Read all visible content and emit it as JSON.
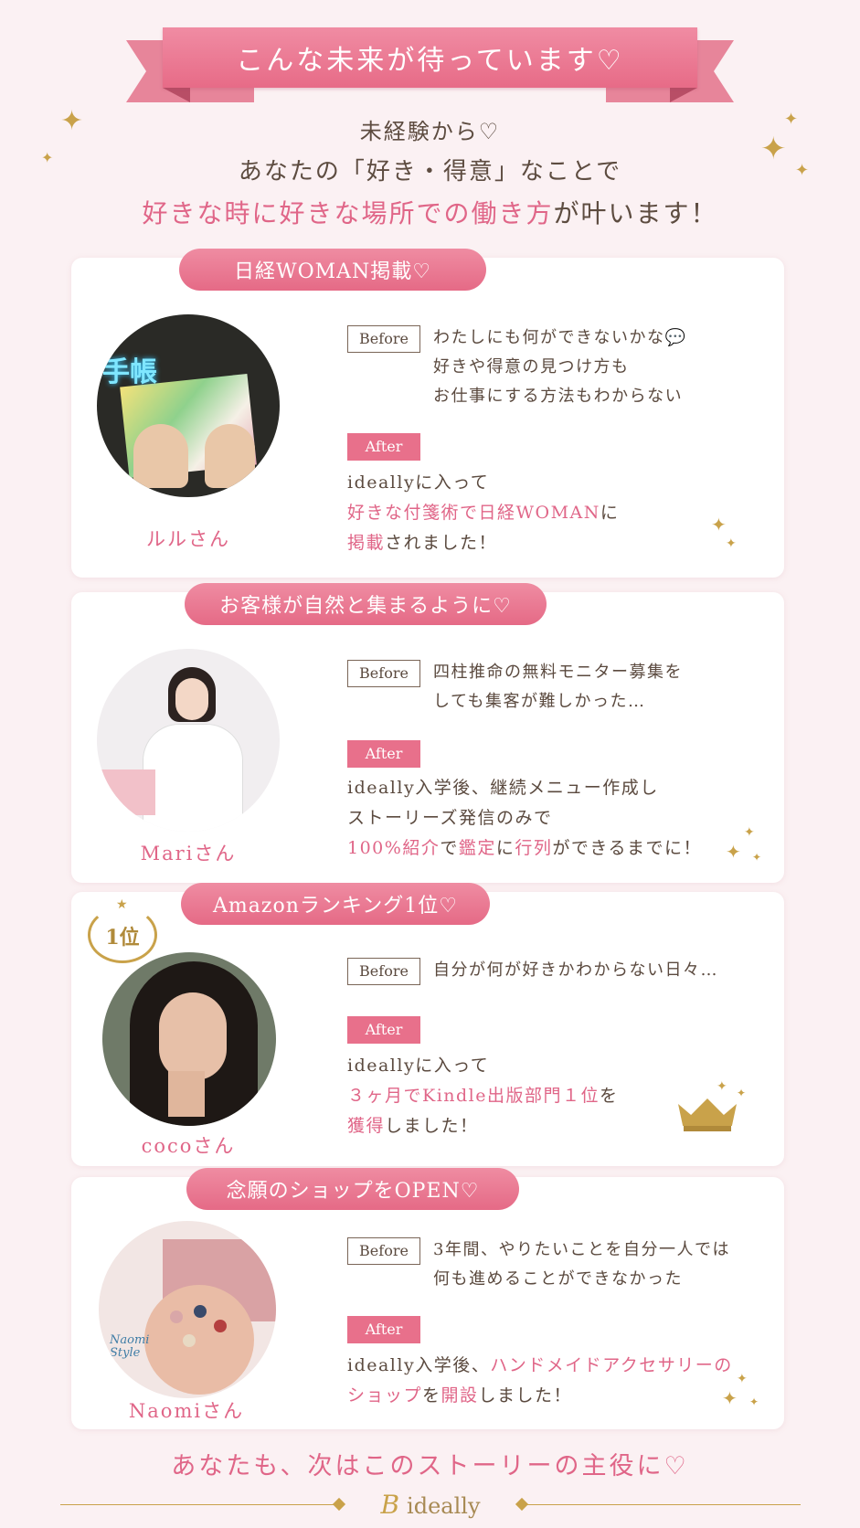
{
  "header": {
    "ribbon_title": "こんな未来が待っています♡"
  },
  "intro": {
    "line1": "未経験から♡",
    "line2": "あなたの「好き・得意」なことで",
    "line3_pink": "好きな時に好きな場所での働き方",
    "line3_rest": "が叶います！"
  },
  "labels": {
    "before": "Before",
    "after": "After"
  },
  "cases": [
    {
      "title": "日経WOMAN掲載♡",
      "name": "ルルさん",
      "photo_text": "手帳",
      "before": [
        "わたしにも何ができないかな💬",
        "好きや得意の見つけ方も",
        "お仕事にする方法もわからない"
      ],
      "after_l1": "ideallyに入って",
      "after_l2_pink": "好きな付箋術で日経WOMAN",
      "after_l2_rest": "に",
      "after_l3_pink": "掲載",
      "after_l3_rest": "されました！"
    },
    {
      "title": "お客様が自然と集まるように♡",
      "name": "Mariさん",
      "before": [
        "四柱推命の無料モニター募集を",
        "しても集客が難しかった…"
      ],
      "after_l1": "ideally入学後、継続メニュー作成し",
      "after_l2": "ストーリーズ発信のみで",
      "after_l3_a": "100%紹介",
      "after_l3_b": "で",
      "after_l3_c": "鑑定",
      "after_l3_d": "に",
      "after_l3_e": "行列",
      "after_l3_f": "ができるまでに！"
    },
    {
      "title": "Amazonランキング1位♡",
      "name": "cocoさん",
      "badge": "1位",
      "before": [
        "自分が何が好きかわからない日々…"
      ],
      "after_l1": "ideallyに入って",
      "after_l2_pink": "３ヶ月でKindle出版部門１位",
      "after_l2_rest": "を",
      "after_l3_pink": "獲得",
      "after_l3_rest": "しました！"
    },
    {
      "title": "念願のショップをOPEN♡",
      "name": "Naomiさん",
      "photo_text": "Naomi Style",
      "before": [
        "3年間、やりたいことを自分一人では",
        "何も進めることができなかった"
      ],
      "after_l1_a": "ideally入学後、",
      "after_l1_b": "ハンドメイドアクセサリーの",
      "after_l2_pink": "ショップ",
      "after_l2_mid": "を",
      "after_l2_pink2": "開設",
      "after_l2_rest": "しました！"
    }
  ],
  "footer": {
    "closing": "あなたも、次はこのストーリーの主役に♡",
    "brand_mark": "B",
    "brand_name": "ideally"
  },
  "colors": {
    "pink": "#e06688",
    "ribbon": "#e76b87",
    "gold": "#c9a24a",
    "text": "#5b4a3f",
    "background": "#fbf1f3"
  }
}
